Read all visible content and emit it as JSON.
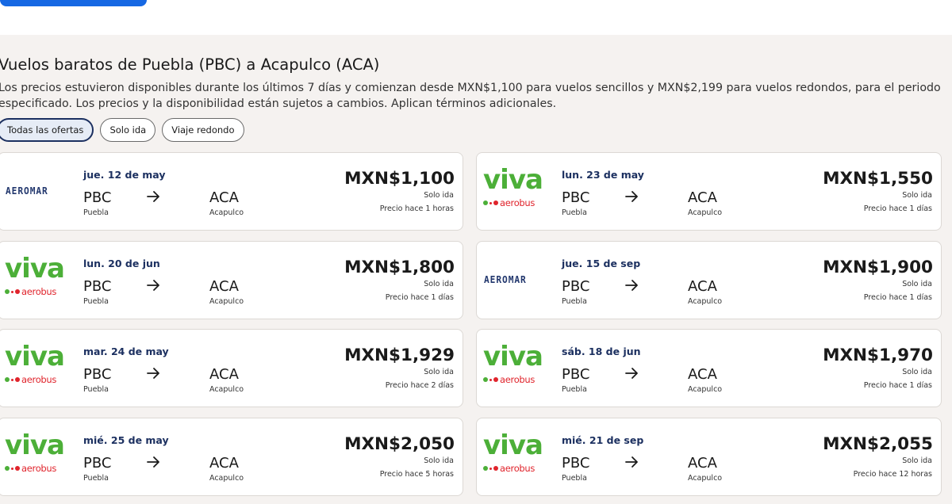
{
  "heading": {
    "title": "Vuelos baratos de Puebla (PBC) a Acapulco (ACA)",
    "description": "Los precios estuvieron disponibles durante los últimos 7 días y comienzan desde MXN$1,100 para vuelos sencillos y MXN$2,199 para vuelos redondos, para el periodo especificado. Los precios y la disponibilidad están sujetos a cambios. Aplican términos adicionales."
  },
  "filters": [
    "Todas las ofertas",
    "Solo ida",
    "Viaje redondo"
  ],
  "airline_logos": {
    "aeromar": "AEROMAR",
    "viva": "viva",
    "viva_sub": "aerobus"
  },
  "colors": {
    "primary_blue": "#1668e3",
    "date_navy": "#1c3060",
    "viva_green": "#4caf38",
    "viva_red": "#e0242c",
    "aeromar_blue": "#23386e"
  },
  "deals": [
    {
      "airline": "aeromar",
      "date": "jue. 12 de may",
      "from_code": "PBC",
      "from_city": "Puebla",
      "to_code": "ACA",
      "to_city": "Acapulco",
      "price": "MXN$1,100",
      "trip": "Solo ida",
      "updated": "Precio hace 1 horas"
    },
    {
      "airline": "viva",
      "date": "lun. 23 de may",
      "from_code": "PBC",
      "from_city": "Puebla",
      "to_code": "ACA",
      "to_city": "Acapulco",
      "price": "MXN$1,550",
      "trip": "Solo ida",
      "updated": "Precio hace 1 días"
    },
    {
      "airline": "viva",
      "date": "lun. 20 de jun",
      "from_code": "PBC",
      "from_city": "Puebla",
      "to_code": "ACA",
      "to_city": "Acapulco",
      "price": "MXN$1,800",
      "trip": "Solo ida",
      "updated": "Precio hace 1 días"
    },
    {
      "airline": "aeromar",
      "date": "jue. 15 de sep",
      "from_code": "PBC",
      "from_city": "Puebla",
      "to_code": "ACA",
      "to_city": "Acapulco",
      "price": "MXN$1,900",
      "trip": "Solo ida",
      "updated": "Precio hace 1 días"
    },
    {
      "airline": "viva",
      "date": "mar. 24 de may",
      "from_code": "PBC",
      "from_city": "Puebla",
      "to_code": "ACA",
      "to_city": "Acapulco",
      "price": "MXN$1,929",
      "trip": "Solo ida",
      "updated": "Precio hace 2 días"
    },
    {
      "airline": "viva",
      "date": "sáb. 18 de jun",
      "from_code": "PBC",
      "from_city": "Puebla",
      "to_code": "ACA",
      "to_city": "Acapulco",
      "price": "MXN$1,970",
      "trip": "Solo ida",
      "updated": "Precio hace 1 días"
    },
    {
      "airline": "viva",
      "date": "mié. 25 de may",
      "from_code": "PBC",
      "from_city": "Puebla",
      "to_code": "ACA",
      "to_city": "Acapulco",
      "price": "MXN$2,050",
      "trip": "Solo ida",
      "updated": "Precio hace 5 horas"
    },
    {
      "airline": "viva",
      "date": "mié. 21 de sep",
      "from_code": "PBC",
      "from_city": "Puebla",
      "to_code": "ACA",
      "to_city": "Acapulco",
      "price": "MXN$2,055",
      "trip": "Solo ida",
      "updated": "Precio hace 12 horas"
    }
  ]
}
